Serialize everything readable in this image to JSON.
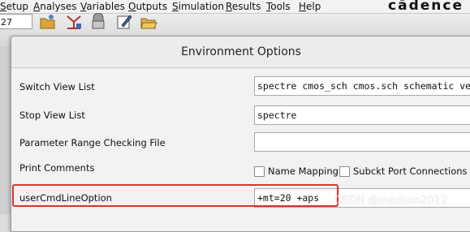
{
  "menubar": {
    "items": [
      "Setup",
      "Analyses",
      "Variables",
      "Outputs",
      "Simulation",
      "Results",
      "Tools",
      "Help"
    ],
    "underline": [
      "S",
      "A",
      "V",
      "O",
      "S",
      "R",
      "T",
      "H"
    ],
    "rest": [
      "etup",
      "nalyses",
      "ariables",
      "utputs",
      "imulation",
      "esults",
      "ools",
      "elp"
    ],
    "brand": "cādence"
  },
  "toolbar": {
    "field_value": "27",
    "icons": [
      "folder-icon",
      "network-icon",
      "save-icon",
      "edit-icon",
      "open-folder-icon"
    ]
  },
  "dialog": {
    "title": "Environment Options",
    "rows": {
      "switch_view_label": "Switch View List",
      "switch_view_value": "spectre cmos_sch cmos.sch schematic veril",
      "stop_view_label": "Stop View List",
      "stop_view_value": "spectre",
      "param_range_label": "Parameter Range Checking File",
      "param_range_value": "",
      "print_comments_label": "Print Comments",
      "name_mapping_label": "Name Mapping",
      "subckt_label": "Subckt Port Connections",
      "user_cmd_label": "userCmdLineOption",
      "user_cmd_value": "+mt=20 +aps"
    }
  },
  "watermark": "CSDN @madson2012",
  "colors": {
    "highlight": "#e03030"
  }
}
